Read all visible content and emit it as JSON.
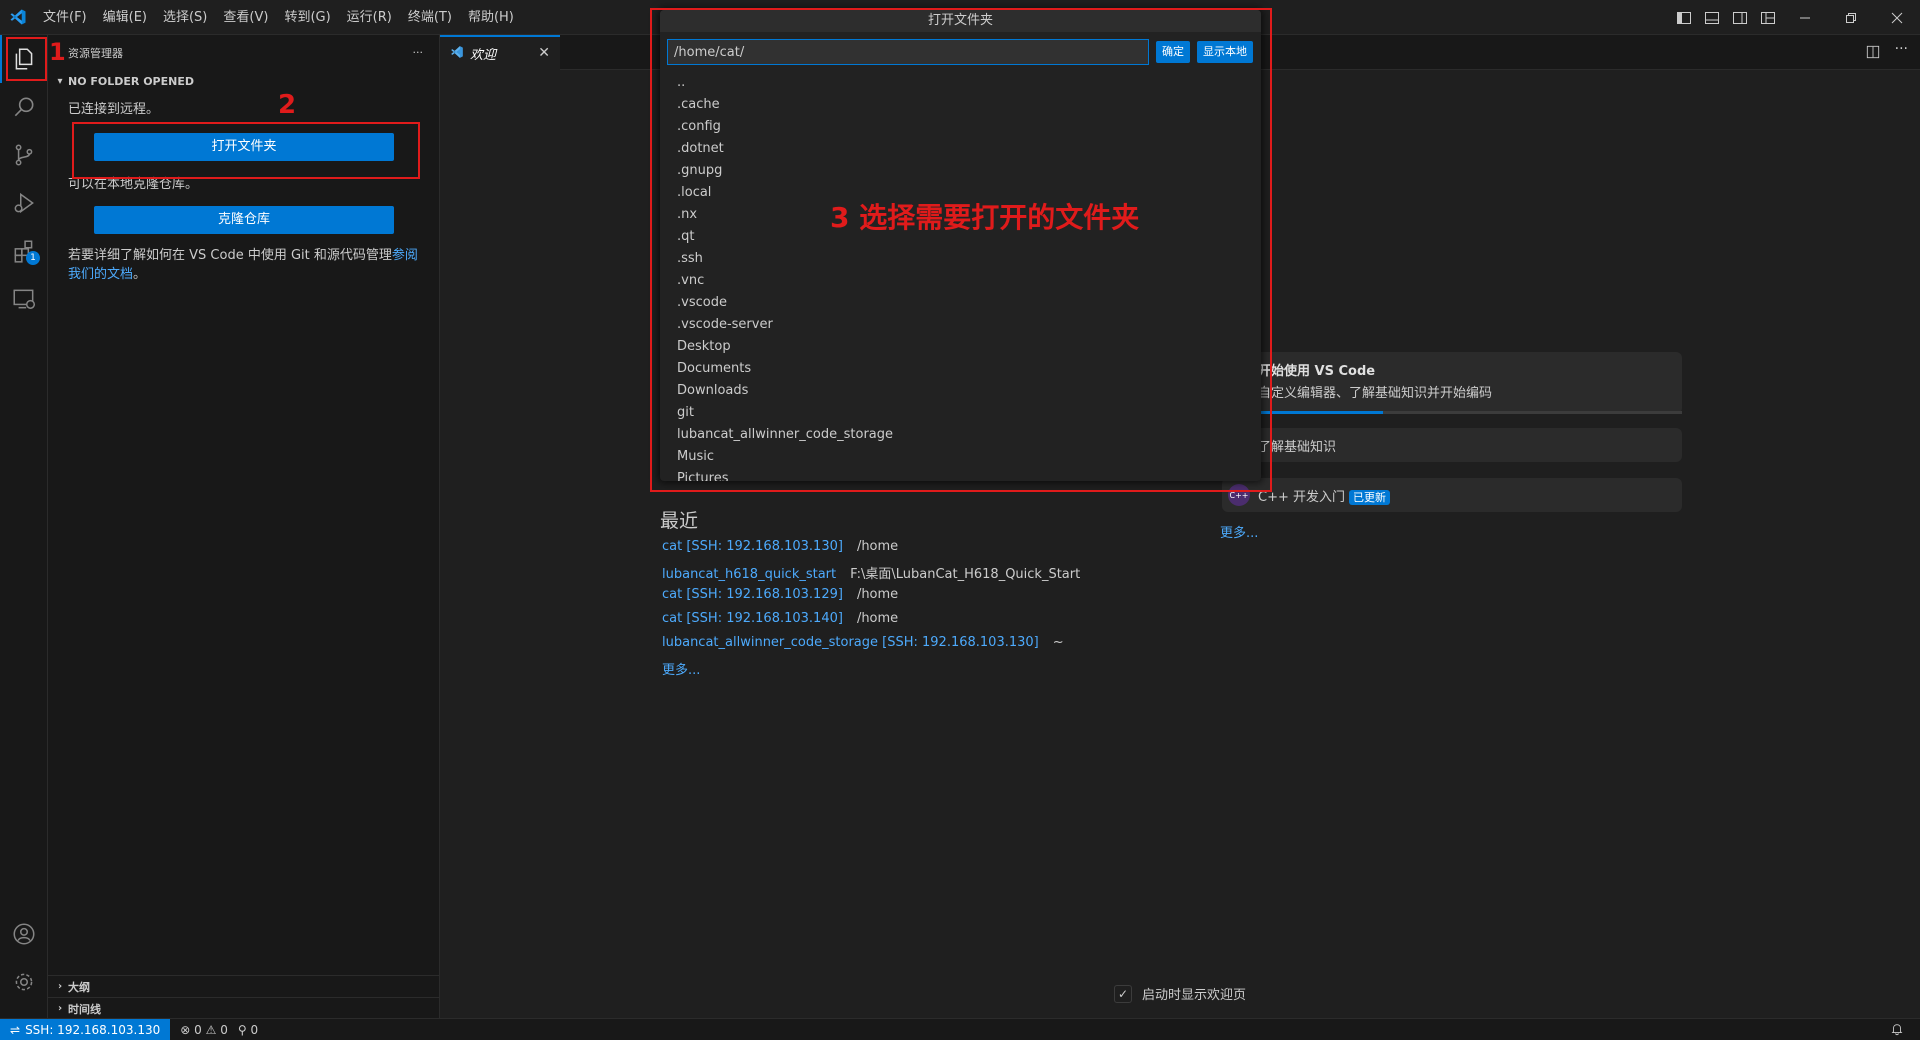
{
  "menu": [
    "文件(F)",
    "编辑(E)",
    "选择(S)",
    "查看(V)",
    "转到(G)",
    "运行(R)",
    "终端(T)",
    "帮助(H)"
  ],
  "activity": {
    "extensions_badge": "1"
  },
  "sidebar": {
    "title": "资源管理器",
    "more": "···",
    "section": "NO FOLDER OPENED",
    "connected_text": "已连接到远程。",
    "open_folder_button": "打开文件夹",
    "clone_text": "可以在本地克隆仓库。",
    "clone_button": "克隆仓库",
    "docs_text": "若要详细了解如何在 VS Code 中使用 Git 和源代码管理",
    "docs_link_a": "参阅",
    "docs_link_b": "我们的文档",
    "docs_end": "。",
    "outline": "大纲",
    "timeline": "时间线"
  },
  "tab": {
    "label": "欢迎",
    "close": "✕"
  },
  "quickpick": {
    "title": "打开文件夹",
    "input_value": "/home/cat/",
    "ok_button": "确定",
    "local_button": "显示本地",
    "items": [
      "..",
      ".cache",
      ".config",
      ".dotnet",
      ".gnupg",
      ".local",
      ".nx",
      ".qt",
      ".ssh",
      ".vnc",
      ".vscode",
      ".vscode-server",
      "Desktop",
      "Documents",
      "Downloads",
      "git",
      "lubancat_allwinner_code_storage",
      "Music",
      "Pictures"
    ]
  },
  "welcome": {
    "recent_title": "最近",
    "recent": [
      {
        "name": "cat [SSH: 192.168.103.130]",
        "path": "/home"
      },
      {
        "name": "lubancat_h618_quick_start",
        "path": "F:\\桌面\\LubanCat_H618_Quick_Start"
      },
      {
        "name": "cat [SSH: 192.168.103.129]",
        "path": "/home"
      },
      {
        "name": "cat [SSH: 192.168.103.140]",
        "path": "/home"
      },
      {
        "name": "lubancat_allwinner_code_storage [SSH: 192.168.103.130]",
        "path": "~"
      }
    ],
    "recent_more": "更多...",
    "walk1_title": "开始使用 VS Code",
    "walk1_desc": "自定义编辑器、了解基础知识并开始编码",
    "walk2_title": "了解基础知识",
    "walk3_title": "C++ 开发入门",
    "walk3_badge": "已更新",
    "walk_more": "更多...",
    "startup_label": "启动时显示欢迎页"
  },
  "annotations": {
    "n1": "1",
    "n2": "2",
    "n3": "3 选择需要打开的文件夹"
  },
  "status": {
    "remote": "SSH: 192.168.103.130",
    "errors": "0",
    "warnings": "0",
    "ports": "0"
  },
  "colors": {
    "accent": "#0078d4",
    "link": "#4daafc",
    "annotation": "#e01b1b"
  }
}
